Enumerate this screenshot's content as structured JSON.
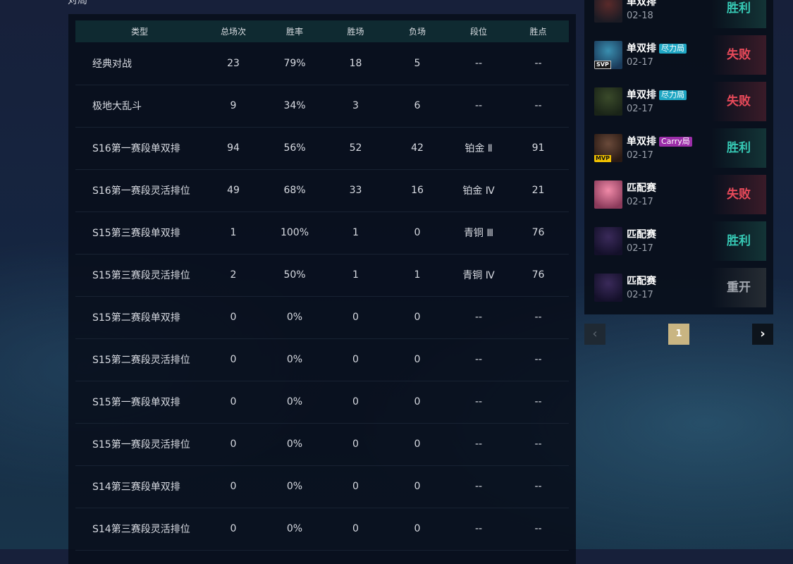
{
  "section_title": "对局",
  "table": {
    "headers": [
      "类型",
      "总场次",
      "胜率",
      "胜场",
      "负场",
      "段位",
      "胜点"
    ],
    "rows": [
      [
        "经典对战",
        "23",
        "79%",
        "18",
        "5",
        "--",
        "--"
      ],
      [
        "极地大乱斗",
        "9",
        "34%",
        "3",
        "6",
        "--",
        "--"
      ],
      [
        "S16第一赛段单双排",
        "94",
        "56%",
        "52",
        "42",
        "铂金 Ⅱ",
        "91"
      ],
      [
        "S16第一赛段灵活排位",
        "49",
        "68%",
        "33",
        "16",
        "铂金 Ⅳ",
        "21"
      ],
      [
        "S15第三赛段单双排",
        "1",
        "100%",
        "1",
        "0",
        "青铜 Ⅲ",
        "76"
      ],
      [
        "S15第三赛段灵活排位",
        "2",
        "50%",
        "1",
        "1",
        "青铜 Ⅳ",
        "76"
      ],
      [
        "S15第二赛段单双排",
        "0",
        "0%",
        "0",
        "0",
        "--",
        "--"
      ],
      [
        "S15第二赛段灵活排位",
        "0",
        "0%",
        "0",
        "0",
        "--",
        "--"
      ],
      [
        "S15第一赛段单双排",
        "0",
        "0%",
        "0",
        "0",
        "--",
        "--"
      ],
      [
        "S15第一赛段灵活排位",
        "0",
        "0%",
        "0",
        "0",
        "--",
        "--"
      ],
      [
        "S14第三赛段单双排",
        "0",
        "0%",
        "0",
        "0",
        "--",
        "--"
      ],
      [
        "S14第三赛段灵活排位",
        "0",
        "0%",
        "0",
        "0",
        "--",
        "--"
      ]
    ]
  },
  "matches": [
    {
      "mode": "单双排",
      "tag": "",
      "tag_color": "",
      "badge": "",
      "date": "02-18",
      "result": "胜利",
      "result_type": "win",
      "avatar_colors": [
        "#5a2a2a",
        "#1b1b24"
      ]
    },
    {
      "mode": "单双排",
      "tag": "尽力局",
      "tag_color": "cyan",
      "badge": "SVP",
      "date": "02-17",
      "result": "失败",
      "result_type": "loss",
      "avatar_colors": [
        "#3a8fb0",
        "#1a3a5a"
      ]
    },
    {
      "mode": "单双排",
      "tag": "尽力局",
      "tag_color": "cyan",
      "badge": "",
      "date": "02-17",
      "result": "失败",
      "result_type": "loss",
      "avatar_colors": [
        "#3a4a2a",
        "#1a2418"
      ]
    },
    {
      "mode": "单双排",
      "tag": "Carry局",
      "tag_color": "purple",
      "badge": "MVP",
      "date": "02-17",
      "result": "胜利",
      "result_type": "win",
      "avatar_colors": [
        "#6a4a3a",
        "#2a1a14"
      ]
    },
    {
      "mode": "匹配赛",
      "tag": "",
      "tag_color": "",
      "badge": "",
      "date": "02-17",
      "result": "失败",
      "result_type": "loss",
      "avatar_colors": [
        "#f08aa8",
        "#8a3a5a"
      ]
    },
    {
      "mode": "匹配赛",
      "tag": "",
      "tag_color": "",
      "badge": "",
      "date": "02-17",
      "result": "胜利",
      "result_type": "win",
      "avatar_colors": [
        "#3a2a5a",
        "#14102a"
      ]
    },
    {
      "mode": "匹配赛",
      "tag": "",
      "tag_color": "",
      "badge": "",
      "date": "02-17",
      "result": "重开",
      "result_type": "redo",
      "avatar_colors": [
        "#3a2a5a",
        "#14102a"
      ]
    }
  ],
  "pagination": {
    "prev": "‹",
    "page": "1",
    "next": "›"
  }
}
